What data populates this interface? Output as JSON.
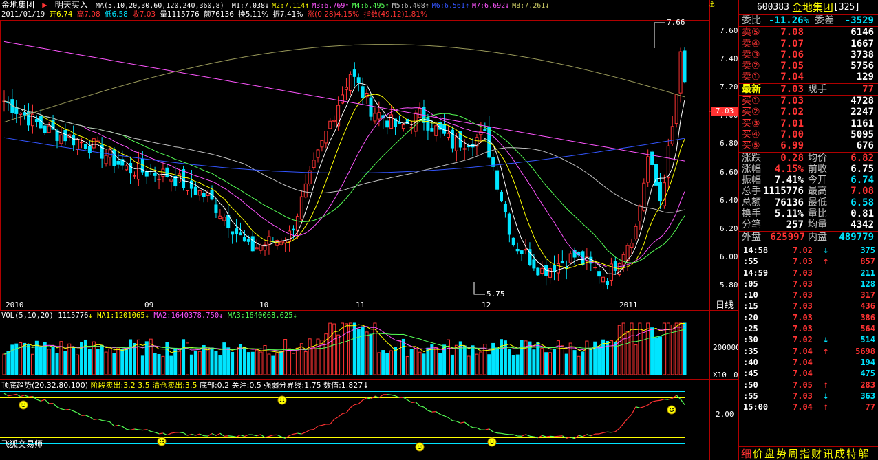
{
  "window": {
    "stock_name": "金地集团",
    "indicator_name": "明天买入",
    "period_label": "日线"
  },
  "price_header": {
    "ma_params": "MA(5,10,20,30,60,120,240,360,8)",
    "ma_values": [
      {
        "label": "M1:7.038",
        "arrow": "↓",
        "color": "#ffffff"
      },
      {
        "label": "M2:7.114",
        "arrow": "↑",
        "color": "#ffff00"
      },
      {
        "label": "M3:6.769",
        "arrow": "↑",
        "color": "#ff55ff"
      },
      {
        "label": "M4:6.495",
        "arrow": "↑",
        "color": "#55ff55"
      },
      {
        "label": "M5:6.408",
        "arrow": "↑",
        "color": "#c0c0c0"
      },
      {
        "label": "M6:6.561",
        "arrow": "↑",
        "color": "#3355ff"
      },
      {
        "label": "M7:6.692",
        "arrow": "↓",
        "color": "#ff55ff"
      },
      {
        "label": "M8:7.261",
        "arrow": "↓",
        "color": "#cccc66"
      }
    ],
    "date": "2011/01/19",
    "open": "开6.74",
    "high": "高7.08",
    "low": "低6.58",
    "close": "收7.03",
    "volume": "量1115776",
    "amount": "额76136",
    "turnover": "换5.11%",
    "amplitude": "振7.41%",
    "change": "涨(0.28)4.15%",
    "index": "指数(49.12)1.81%"
  },
  "price_axis": [
    "7.60",
    "7.40",
    "7.20",
    "7.00",
    "6.80",
    "6.60",
    "6.40",
    "6.20",
    "6.00",
    "5.80"
  ],
  "current_price_tag": "7.03",
  "high_mark": "7.66",
  "low_mark": "5.75",
  "date_axis": [
    "2010",
    "09",
    "10",
    "11",
    "12",
    "2011"
  ],
  "volume_header": {
    "params": "VOL(5,10,20)",
    "vol": "1115776",
    "ma1": "MA1:1201065",
    "ma2": "MA2:1640378.750",
    "ma3": "MA3:1640068.625"
  },
  "volume_axis": {
    "top": "200000",
    "bottom": "0",
    "unit": "X10"
  },
  "indicator_header": {
    "name": "顶底趋势(20,32,80,100)",
    "sell_stage": "阶段卖出:3.2",
    "v35a": "3.5",
    "clear": "清仓卖出:3.5",
    "bottom": "底部:0.2",
    "watch": "关注:0.5",
    "line": "强弱分界线:1.75",
    "value": "数值:1.827"
  },
  "indicator_axis": "2.00",
  "watermark": "飞狐交易师",
  "quote": {
    "code": "600383",
    "name": "金地集团",
    "count": "[325]",
    "ratio_label": "委比",
    "ratio": "-11.26%",
    "diff_label": "委差",
    "diff": "-3529",
    "sells": [
      {
        "label": "卖⑤",
        "price": "7.08",
        "vol": "6146"
      },
      {
        "label": "卖④",
        "price": "7.07",
        "vol": "1667"
      },
      {
        "label": "卖③",
        "price": "7.06",
        "vol": "3738"
      },
      {
        "label": "卖②",
        "price": "7.05",
        "vol": "5756"
      },
      {
        "label": "卖①",
        "price": "7.04",
        "vol": "129"
      }
    ],
    "last": {
      "label": "最新",
      "price": "7.03",
      "label2": "现手",
      "vol": "77"
    },
    "buys": [
      {
        "label": "买①",
        "price": "7.03",
        "vol": "4728"
      },
      {
        "label": "买②",
        "price": "7.02",
        "vol": "2247"
      },
      {
        "label": "买③",
        "price": "7.01",
        "vol": "1161"
      },
      {
        "label": "买④",
        "price": "7.00",
        "vol": "5095"
      },
      {
        "label": "买⑤",
        "price": "6.99",
        "vol": "676"
      }
    ],
    "stats": [
      {
        "l1": "涨跌",
        "v1": "0.28",
        "c1": "#ff3333",
        "l2": "均价",
        "v2": "6.82",
        "c2": "#ff3333"
      },
      {
        "l1": "涨幅",
        "v1": "4.15%",
        "c1": "#ff3333",
        "l2": "前收",
        "v2": "6.75",
        "c2": "#ffffff"
      },
      {
        "l1": "振幅",
        "v1": "7.41%",
        "c1": "#ffffff",
        "l2": "今开",
        "v2": "6.74",
        "c2": "#00e5ff"
      },
      {
        "l1": "总手",
        "v1": "1115776",
        "c1": "#ffffff",
        "l2": "最高",
        "v2": "7.08",
        "c2": "#ff3333"
      },
      {
        "l1": "总额",
        "v1": "76136",
        "c1": "#ffffff",
        "l2": "最低",
        "v2": "6.58",
        "c2": "#00e5ff"
      },
      {
        "l1": "换手",
        "v1": "5.11%",
        "c1": "#ffffff",
        "l2": "量比",
        "v2": "0.81",
        "c2": "#ffffff"
      },
      {
        "l1": "分笔",
        "v1": "257",
        "c1": "#ffffff",
        "l2": "均量",
        "v2": "4342",
        "c2": "#ffffff"
      }
    ],
    "outer_label": "外盘",
    "outer": "625997",
    "inner_label": "内盘",
    "inner": "489779",
    "ticks": [
      {
        "t": "14:58",
        "p": "7.02",
        "ar": "↓",
        "v": "375",
        "up": false
      },
      {
        "t": ":55",
        "p": "7.03",
        "ar": "↑",
        "v": "857",
        "up": true
      },
      {
        "t": "14:59",
        "p": "7.03",
        "ar": "",
        "v": "211",
        "up": false
      },
      {
        "t": ":05",
        "p": "7.03",
        "ar": "",
        "v": "128",
        "up": false
      },
      {
        "t": ":10",
        "p": "7.03",
        "ar": "",
        "v": "317",
        "up": true
      },
      {
        "t": ":15",
        "p": "7.03",
        "ar": "",
        "v": "436",
        "up": true
      },
      {
        "t": ":20",
        "p": "7.03",
        "ar": "",
        "v": "386",
        "up": true
      },
      {
        "t": ":25",
        "p": "7.03",
        "ar": "",
        "v": "564",
        "up": true
      },
      {
        "t": ":30",
        "p": "7.02",
        "ar": "↓",
        "v": "514",
        "up": false
      },
      {
        "t": ":35",
        "p": "7.04",
        "ar": "↑",
        "v": "5698",
        "up": true
      },
      {
        "t": ":40",
        "p": "7.04",
        "ar": "",
        "v": "194",
        "up": false
      },
      {
        "t": ":45",
        "p": "7.04",
        "ar": "",
        "v": "475",
        "up": false
      },
      {
        "t": ":50",
        "p": "7.05",
        "ar": "↑",
        "v": "283",
        "up": true
      },
      {
        "t": ":55",
        "p": "7.03",
        "ar": "↓",
        "v": "363",
        "up": false
      },
      {
        "t": "15:00",
        "p": "7.04",
        "ar": "↑",
        "v": "77",
        "up": true
      }
    ],
    "footer": [
      "细",
      "价",
      "盘",
      "势",
      "周",
      "指",
      "财",
      "讯",
      "成",
      "特",
      "解"
    ]
  },
  "colors": {
    "up": "#ff3333",
    "down": "#00e5ff",
    "frame": "#b00000"
  }
}
